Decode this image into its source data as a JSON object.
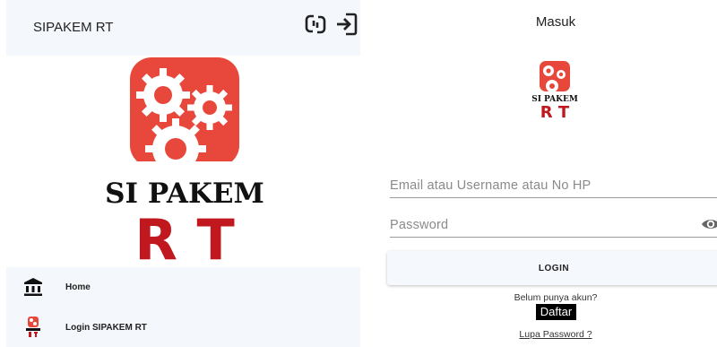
{
  "left": {
    "header": {
      "title": "SIPAKEM RT",
      "sync_icon": "sync-icon",
      "login_icon": "login-icon"
    },
    "logo": {
      "line1": "SI PAKEM",
      "line2": "R T",
      "accent_color": "#e8473c",
      "rt_color": "#c0181e"
    },
    "drawer": [
      {
        "label": "Home",
        "icon": "bank-icon"
      },
      {
        "label": "Login SIPAKEM RT",
        "icon": "app-logo-icon"
      }
    ]
  },
  "right": {
    "title": "Masuk",
    "logo": {
      "line1": "SI PAKEM",
      "line2": "R T"
    },
    "email_placeholder": "Email atau Username atau No HP",
    "password_placeholder": "Password",
    "login_label": "LOGIN",
    "register_prompt": "Belum punya akun?",
    "register_label": "Daftar",
    "forgot_label": "Lupa Password ?"
  }
}
